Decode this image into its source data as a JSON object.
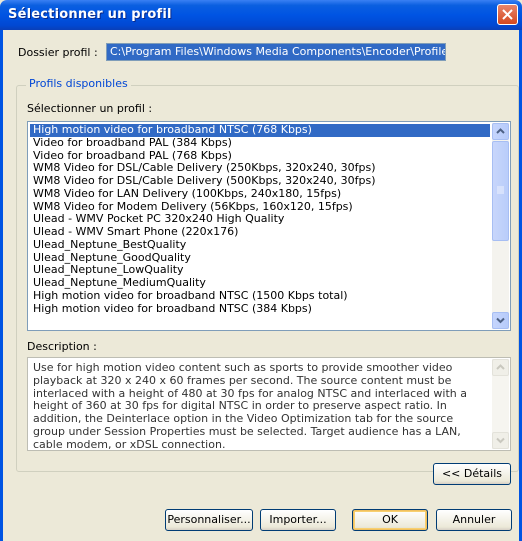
{
  "window": {
    "title": "Sélectionner un profil"
  },
  "dossier": {
    "label": "Dossier profil :",
    "value": "C:\\Program Files\\Windows Media Components\\Encoder\\Profiles\\"
  },
  "group": {
    "title": "Profils disponibles",
    "select_label": "Sélectionner un profil :"
  },
  "profiles": [
    "High motion video for broadband NTSC (768 Kbps)",
    "Video for broadband PAL (384 Kbps)",
    "Video for broadband PAL (768 Kbps)",
    "WM8 Video for DSL/Cable Delivery (250Kbps, 320x240, 30fps)",
    "WM8 Video for DSL/Cable Delivery (500Kbps, 320x240, 30fps)",
    "WM8 Video for LAN Delivery (100Kbps, 240x180, 15fps)",
    "WM8 Video for Modem Delivery (56Kbps, 160x120, 15fps)",
    "Ulead - WMV Pocket PC 320x240 High Quality",
    "Ulead - WMV Smart Phone (220x176)",
    "Ulead_Neptune_BestQuality",
    "Ulead_Neptune_GoodQuality",
    "Ulead_Neptune_LowQuality",
    "Ulead_Neptune_MediumQuality",
    "High motion video for broadband NTSC (1500 Kbps total)",
    "High motion video for broadband NTSC (384 Kbps)"
  ],
  "selected_profile": "High motion video for broadband NTSC (768 Kbps)",
  "description": {
    "label": "Description :",
    "text": "Use for high motion video content such as sports to provide smoother video playback at 320 x 240 x 60 frames per second. The source content must be interlaced with a height of 480 at 30 fps for analog NTSC and interlaced with a height of 360 at 30 fps for digital NTSC in order to preserve aspect ratio. In addition, the Deinterlace option in the Video Optimization tab for the source group under Session Properties must be selected. Target audience has a LAN,  cable modem, or xDSL connection."
  },
  "buttons": {
    "details": "<< Détails",
    "customize": "Personnaliser...",
    "import": "Importer...",
    "ok": "OK",
    "cancel": "Annuler"
  }
}
